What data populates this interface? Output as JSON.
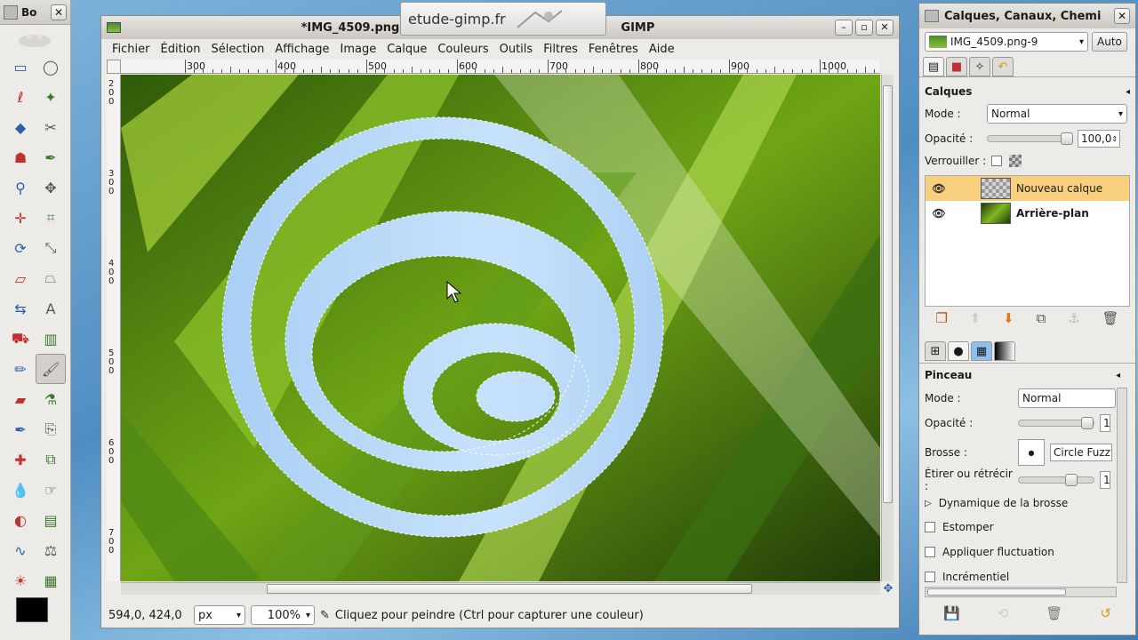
{
  "toolbox": {
    "title": "Bo",
    "fg_color": "#000000",
    "bg_color": "#ffffff",
    "tools": [
      "rect-select-icon",
      "ellipse-select-icon",
      "lasso-icon",
      "magic-wand-icon",
      "select-by-color-icon",
      "scissors-icon",
      "foreground-select-icon",
      "paths-icon",
      "color-picker-icon",
      "move-icon",
      "align-icon",
      "crop-icon",
      "rotate-icon",
      "scale-icon",
      "shear-icon",
      "perspective-icon",
      "flip-icon",
      "text-icon",
      "bucket-fill-icon",
      "gradient-icon",
      "pencil-icon",
      "paintbrush-icon",
      "eraser-icon",
      "airbrush-icon",
      "ink-icon",
      "clone-icon",
      "heal-icon",
      "perspective-clone-icon",
      "blur-icon",
      "smudge-icon",
      "dodge-burn-icon",
      "levels-icon",
      "curves-icon",
      "color-balance-icon",
      "brightness-icon",
      "histogram-icon"
    ]
  },
  "image_window": {
    "title": "*IMG_4509.png",
    "title_suffix": "GIMP",
    "watermark": "etude-gimp.fr",
    "menu": [
      "Fichier",
      "Édition",
      "Sélection",
      "Affichage",
      "Image",
      "Calque",
      "Couleurs",
      "Outils",
      "Filtres",
      "Fenêtres",
      "Aide"
    ],
    "ruler_h": [
      "300",
      "400",
      "500",
      "600",
      "700",
      "800",
      "900",
      "1000"
    ],
    "ruler_v": [
      "200",
      "300",
      "400",
      "500",
      "600",
      "700"
    ],
    "status": {
      "coords": "594,0, 424,0",
      "unit": "px",
      "zoom": "100%",
      "message": "Cliquez pour peindre (Ctrl pour capturer une couleur)"
    }
  },
  "dock": {
    "title": "Calques, Canaux, Chemi",
    "image_select": "IMG_4509.png-9",
    "auto_label": "Auto",
    "layers": {
      "heading": "Calques",
      "mode_label": "Mode :",
      "mode_value": "Normal",
      "opacity_label": "Opacité :",
      "opacity_value": "100,0",
      "opacity_fraction": 1.0,
      "lock_label": "Verrouiller :",
      "items": [
        {
          "name": "Nouveau calque",
          "selected": true
        },
        {
          "name": "Arrière-plan",
          "selected": false
        }
      ]
    },
    "brush": {
      "heading": "Pinceau",
      "mode_label": "Mode :",
      "mode_value": "Normal",
      "opacity_label": "Opacité :",
      "opacity_value": "1",
      "brush_label": "Brosse :",
      "brush_name": "Circle Fuzzy",
      "scale_label": "Étirer ou rétrécir :",
      "scale_value": "1",
      "dynamics_label": "Dynamique de la brosse",
      "options": [
        "Estomper",
        "Appliquer fluctuation",
        "Incrémentiel"
      ]
    }
  }
}
